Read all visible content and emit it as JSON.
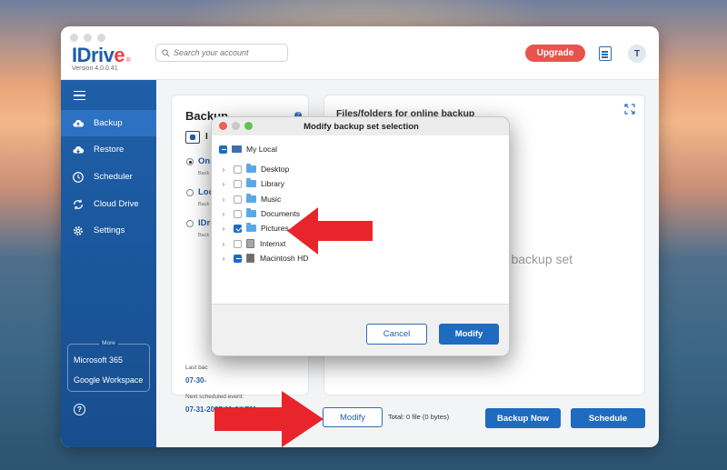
{
  "app": {
    "logo_text": "IDriv",
    "logo_e": "e",
    "logo_reg": "®",
    "version": "Version 4.0.0.41"
  },
  "search": {
    "placeholder": "Search your account"
  },
  "header": {
    "upgrade_label": "Upgrade",
    "avatar_initial": "T"
  },
  "sidebar": {
    "items": [
      {
        "label": "Backup",
        "icon": "cloud-upload-icon"
      },
      {
        "label": "Restore",
        "icon": "cloud-download-icon"
      },
      {
        "label": "Scheduler",
        "icon": "clock-icon"
      },
      {
        "label": "Cloud Drive",
        "icon": "sync-icon"
      },
      {
        "label": "Settings",
        "icon": "gear-icon"
      }
    ],
    "more_label": "More",
    "more_items": [
      "Microsoft 365",
      "Google Workspace"
    ],
    "help_glyph": "?"
  },
  "backup_panel": {
    "title": "Backup",
    "help_glyph": "?",
    "device_initial": "I",
    "options": [
      {
        "label": "Onl",
        "sub": "Back",
        "selected": true
      },
      {
        "label": "Loc",
        "sub": "Back",
        "selected": false
      },
      {
        "label": "IDri",
        "sub": "Back",
        "selected": false
      }
    ],
    "last_backup_label": "Last bac",
    "last_backup_value": "07-30-",
    "next_event_label": "Next scheduled event:",
    "next_event_value": "07-31-2025 11:04 PM"
  },
  "files_panel": {
    "title": "Files/folders for online backup",
    "empty_hint": "he backup set"
  },
  "bottom_bar": {
    "modify_label": "Modify",
    "total_text": "Total: 0 file (0 bytes)",
    "backup_now_label": "Backup Now",
    "schedule_label": "Schedule"
  },
  "dialog": {
    "title": "Modify backup set selection",
    "root": {
      "label": "My Local",
      "state": "partial"
    },
    "items": [
      {
        "label": "Desktop",
        "type": "folder",
        "checked": false
      },
      {
        "label": "Library",
        "type": "folder",
        "checked": false
      },
      {
        "label": "Music",
        "type": "folder",
        "checked": false
      },
      {
        "label": "Documents",
        "type": "folder",
        "checked": false
      },
      {
        "label": "Pictures",
        "type": "folder",
        "checked": true
      },
      {
        "label": "Internxt",
        "type": "drive",
        "checked": false
      },
      {
        "label": "Macintosh HD",
        "type": "drive",
        "checked": "partial"
      }
    ],
    "cancel_label": "Cancel",
    "modify_label": "Modify"
  },
  "colors": {
    "brand_blue": "#1f5fa8",
    "button_blue": "#1f6bbf",
    "upgrade_red": "#e9534d",
    "arrow_red": "#e8252b"
  }
}
